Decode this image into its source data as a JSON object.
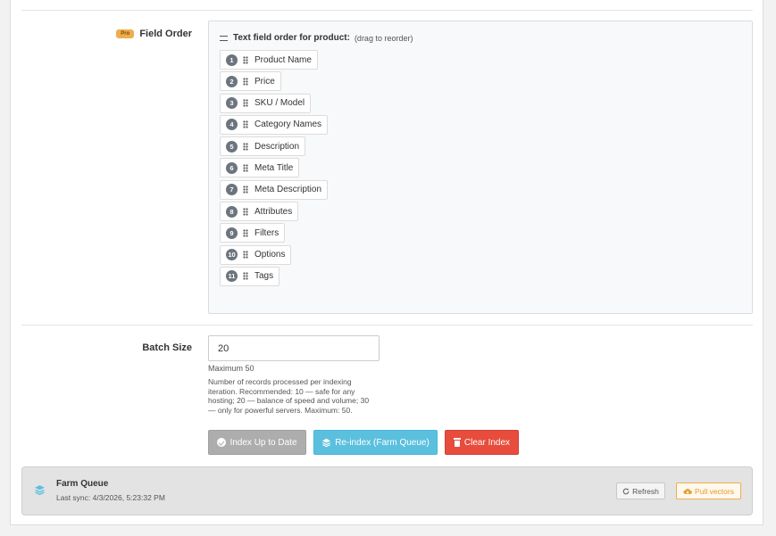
{
  "field_order": {
    "badge": "Pro",
    "label": "Field Order",
    "header_title": "Text field order for product:",
    "header_hint": "(drag to reorder)",
    "items": [
      {
        "num": "1",
        "label": "Product Name"
      },
      {
        "num": "2",
        "label": "Price"
      },
      {
        "num": "3",
        "label": "SKU / Model"
      },
      {
        "num": "4",
        "label": "Category Names"
      },
      {
        "num": "5",
        "label": "Description"
      },
      {
        "num": "6",
        "label": "Meta Title"
      },
      {
        "num": "7",
        "label": "Meta Description"
      },
      {
        "num": "8",
        "label": "Attributes"
      },
      {
        "num": "9",
        "label": "Filters"
      },
      {
        "num": "10",
        "label": "Options"
      },
      {
        "num": "11",
        "label": "Tags"
      }
    ]
  },
  "batch": {
    "label": "Batch Size",
    "value": "20",
    "max_text": "Maximum 50",
    "help": "Number of records processed per indexing iteration. Recommended: 10 — safe for any hosting; 20 — balance of speed and volume; 30 — only for powerful servers. Maximum: 50."
  },
  "actions": {
    "index_up_to_date": "Index Up to Date",
    "reindex": "Re-index (Farm Queue)",
    "clear_index": "Clear Index"
  },
  "farm_queue": {
    "title": "Farm Queue",
    "last_sync": "Last sync: 4/3/2026, 5:23:32 PM",
    "refresh": "Refresh",
    "pull_vectors": "Pull vectors"
  },
  "colors": {
    "info": "#5bc0de",
    "danger": "#e74c3c",
    "warning": "#f0ad4e",
    "muted": "#adadad"
  }
}
